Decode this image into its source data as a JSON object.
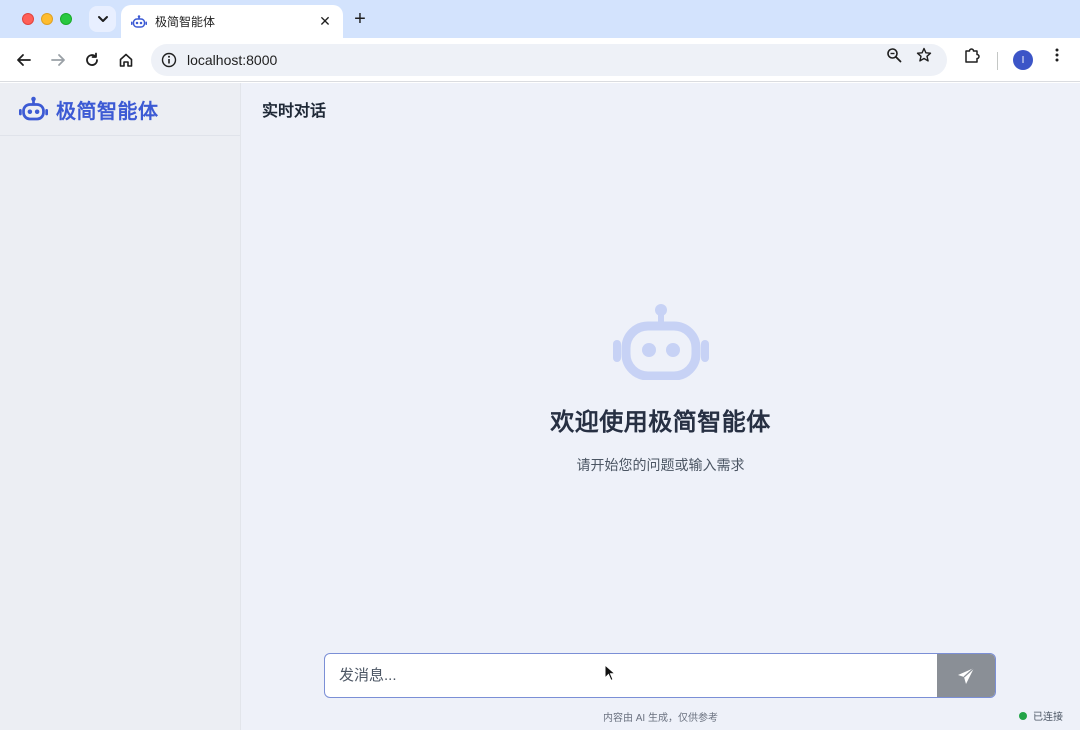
{
  "browser": {
    "tab_title": "极简智能体",
    "url": "localhost:8000",
    "profile_initial": "I"
  },
  "sidebar": {
    "brand_name": "极简智能体"
  },
  "main": {
    "page_title": "实时对话",
    "welcome_title": "欢迎使用极简智能体",
    "welcome_subtitle": "请开始您的问题或输入需求"
  },
  "composer": {
    "placeholder": "发消息..."
  },
  "footer": {
    "disclaimer": "内容由 AI 生成，仅供参考",
    "connection_status": "已连接"
  },
  "colors": {
    "brand": "#3c5ad4",
    "robot_light": "#c7d2f5",
    "status_green": "#22a447",
    "send_button": "#8a8f96"
  }
}
